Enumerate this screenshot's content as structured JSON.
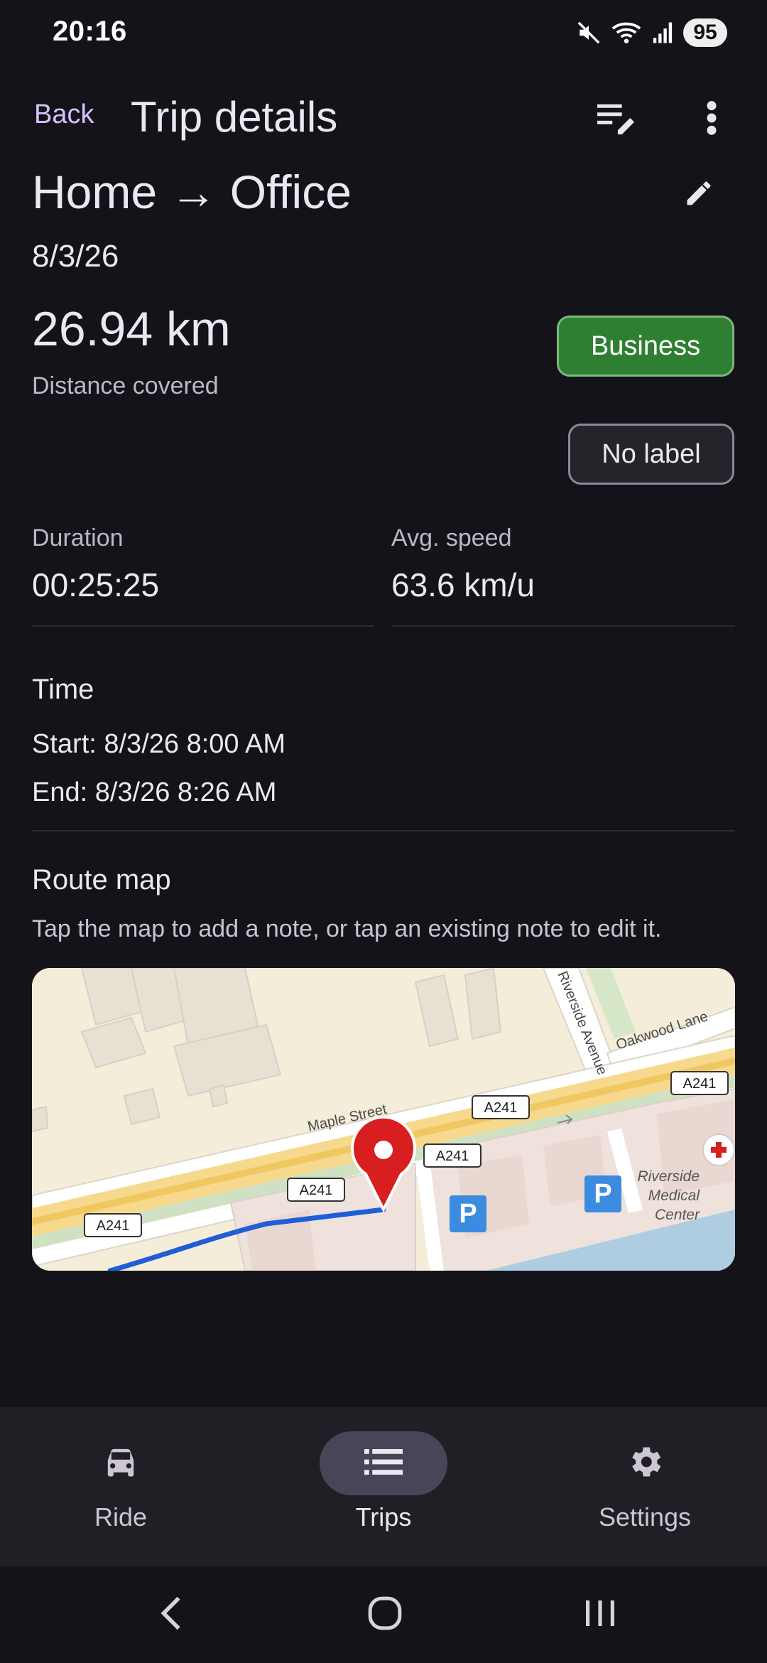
{
  "status_bar": {
    "time": "20:16",
    "battery": "95",
    "icons": [
      "mute-icon",
      "wifi-icon",
      "signal-icon"
    ]
  },
  "app_bar": {
    "back_label": "Back",
    "title": "Trip details",
    "icons": [
      "edit-list-icon",
      "more-vert-icon"
    ]
  },
  "trip": {
    "title": "Home → Office",
    "date": "8/3/26",
    "distance": "26.94 km",
    "distance_label": "Distance covered",
    "business_label": "Business",
    "no_label_label": "No label"
  },
  "stats": {
    "duration_label": "Duration",
    "duration_value": "00:25:25",
    "avg_speed_label": "Avg. speed",
    "avg_speed_value": "63.6 km/u"
  },
  "time_section": {
    "title": "Time",
    "start": "Start: 8/3/26 8:00 AM",
    "end": "End: 8/3/26 8:26 AM"
  },
  "route_map": {
    "title": "Route map",
    "hint": "Tap the map to add a note, or tap an existing note to edit it.",
    "labels": {
      "riverside_avenue": "Riverside Avenue",
      "oakwood_lane": "Oakwood Lane",
      "maple_street": "Maple Street",
      "medical_center": [
        "Riverside",
        "Medical",
        "Center"
      ],
      "road_shield": "A241",
      "parking": "P"
    }
  },
  "bottom_nav": {
    "items": [
      {
        "label": "Ride",
        "icon": "car-icon"
      },
      {
        "label": "Trips",
        "icon": "list-icon"
      },
      {
        "label": "Settings",
        "icon": "gear-icon"
      }
    ],
    "active": "Trips"
  },
  "colors": {
    "accent": "#d7c2ff",
    "business_green": "#2f7f32",
    "route_blue": "#1f5ed8",
    "pin_red": "#d81e1e"
  }
}
